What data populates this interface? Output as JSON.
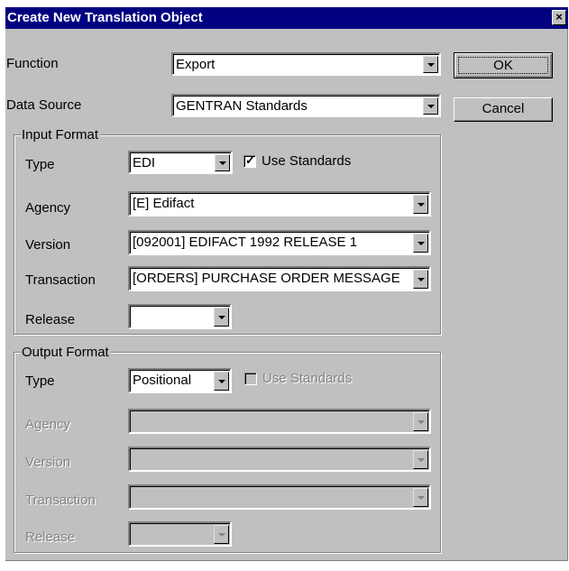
{
  "dialog": {
    "title": "Create New Translation Object",
    "close_glyph": "×"
  },
  "main": {
    "function": {
      "label": "Function",
      "value": "Export"
    },
    "data_source": {
      "label": "Data Source",
      "value": "GENTRAN Standards"
    }
  },
  "buttons": {
    "ok": "OK",
    "cancel": "Cancel"
  },
  "input_format": {
    "legend": "Input Format",
    "type": {
      "label": "Type",
      "value": "EDI"
    },
    "use_standards": {
      "label": "Use Standards",
      "checked": true
    },
    "agency": {
      "label": "Agency",
      "value": "[E] Edifact"
    },
    "version": {
      "label": "Version",
      "value": "[092001] EDIFACT 1992 RELEASE 1"
    },
    "transaction": {
      "label": "Transaction",
      "value": "[ORDERS] PURCHASE ORDER MESSAGE"
    },
    "release": {
      "label": "Release",
      "value": ""
    }
  },
  "output_format": {
    "legend": "Output Format",
    "type": {
      "label": "Type",
      "value": "Positional"
    },
    "use_standards": {
      "label": "Use Standards",
      "checked": false,
      "enabled": false
    },
    "agency": {
      "label": "Agency",
      "value": "",
      "enabled": false
    },
    "version": {
      "label": "Version",
      "value": "",
      "enabled": false
    },
    "transaction": {
      "label": "Transaction",
      "value": "",
      "enabled": false
    },
    "release": {
      "label": "Release",
      "value": "",
      "enabled": false
    }
  },
  "colors": {
    "title_bar": "#000080",
    "face": "#c0c0c0",
    "disabled_text": "#848484"
  }
}
